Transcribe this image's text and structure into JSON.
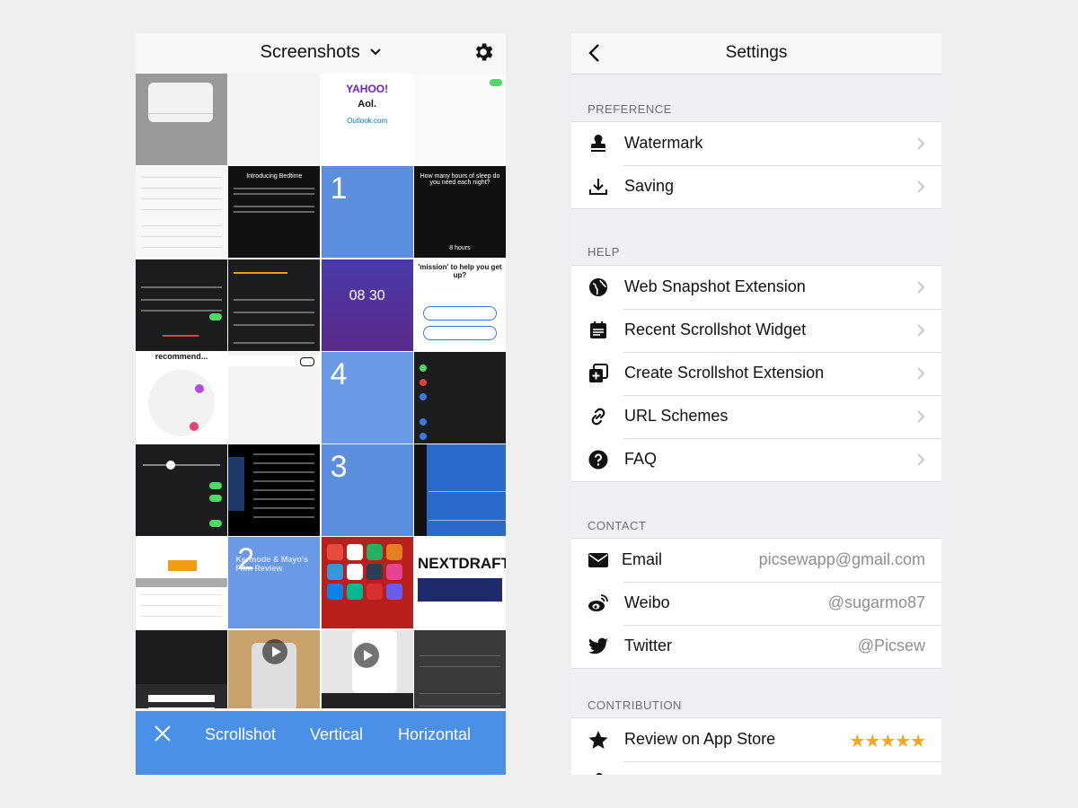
{
  "left": {
    "title": "Screenshots",
    "toolbar": {
      "scrollshot": "Scrollshot",
      "vertical": "Vertical",
      "horizontal": "Horizontal"
    },
    "thumbnails": {
      "t3_yahoo": "YAHOO!",
      "t3_aol": "Aol.",
      "t3_outlook": "Outlook.com",
      "t5_title": "Introducing Bedtime",
      "t6_num": "1",
      "t7_title": "How many hours of sleep do you need each night?",
      "t7_hours": "8 hours",
      "t10_times": "08 30",
      "t11_title": "'mission' to help you get up?",
      "t13_title": "recommend...",
      "t15_num": "4",
      "t19_num": "3",
      "t22_num": "2",
      "t22_text": "Kermode & Mayo's Film Review",
      "t24_title": "NEXTDRAFT"
    }
  },
  "right": {
    "title": "Settings",
    "sections": {
      "preference": "PREFERENCE",
      "help": "HELP",
      "contact": "CONTACT",
      "contribution": "CONTRIBUTION"
    },
    "preference": {
      "watermark": "Watermark",
      "saving": "Saving"
    },
    "help": {
      "web_snapshot": "Web Snapshot Extension",
      "recent_widget": "Recent Scrollshot Widget",
      "create_extension": "Create Scrollshot Extension",
      "url_schemes": "URL Schemes",
      "faq": "FAQ"
    },
    "contact": {
      "email_label": "Email",
      "email_value": "picsewapp@gmail.com",
      "weibo_label": "Weibo",
      "weibo_value": "@sugarmo87",
      "twitter_label": "Twitter",
      "twitter_value": "@Picsew"
    },
    "contribution": {
      "review": "Review on App Store",
      "stars": "★★★★★",
      "rating": 5
    }
  }
}
